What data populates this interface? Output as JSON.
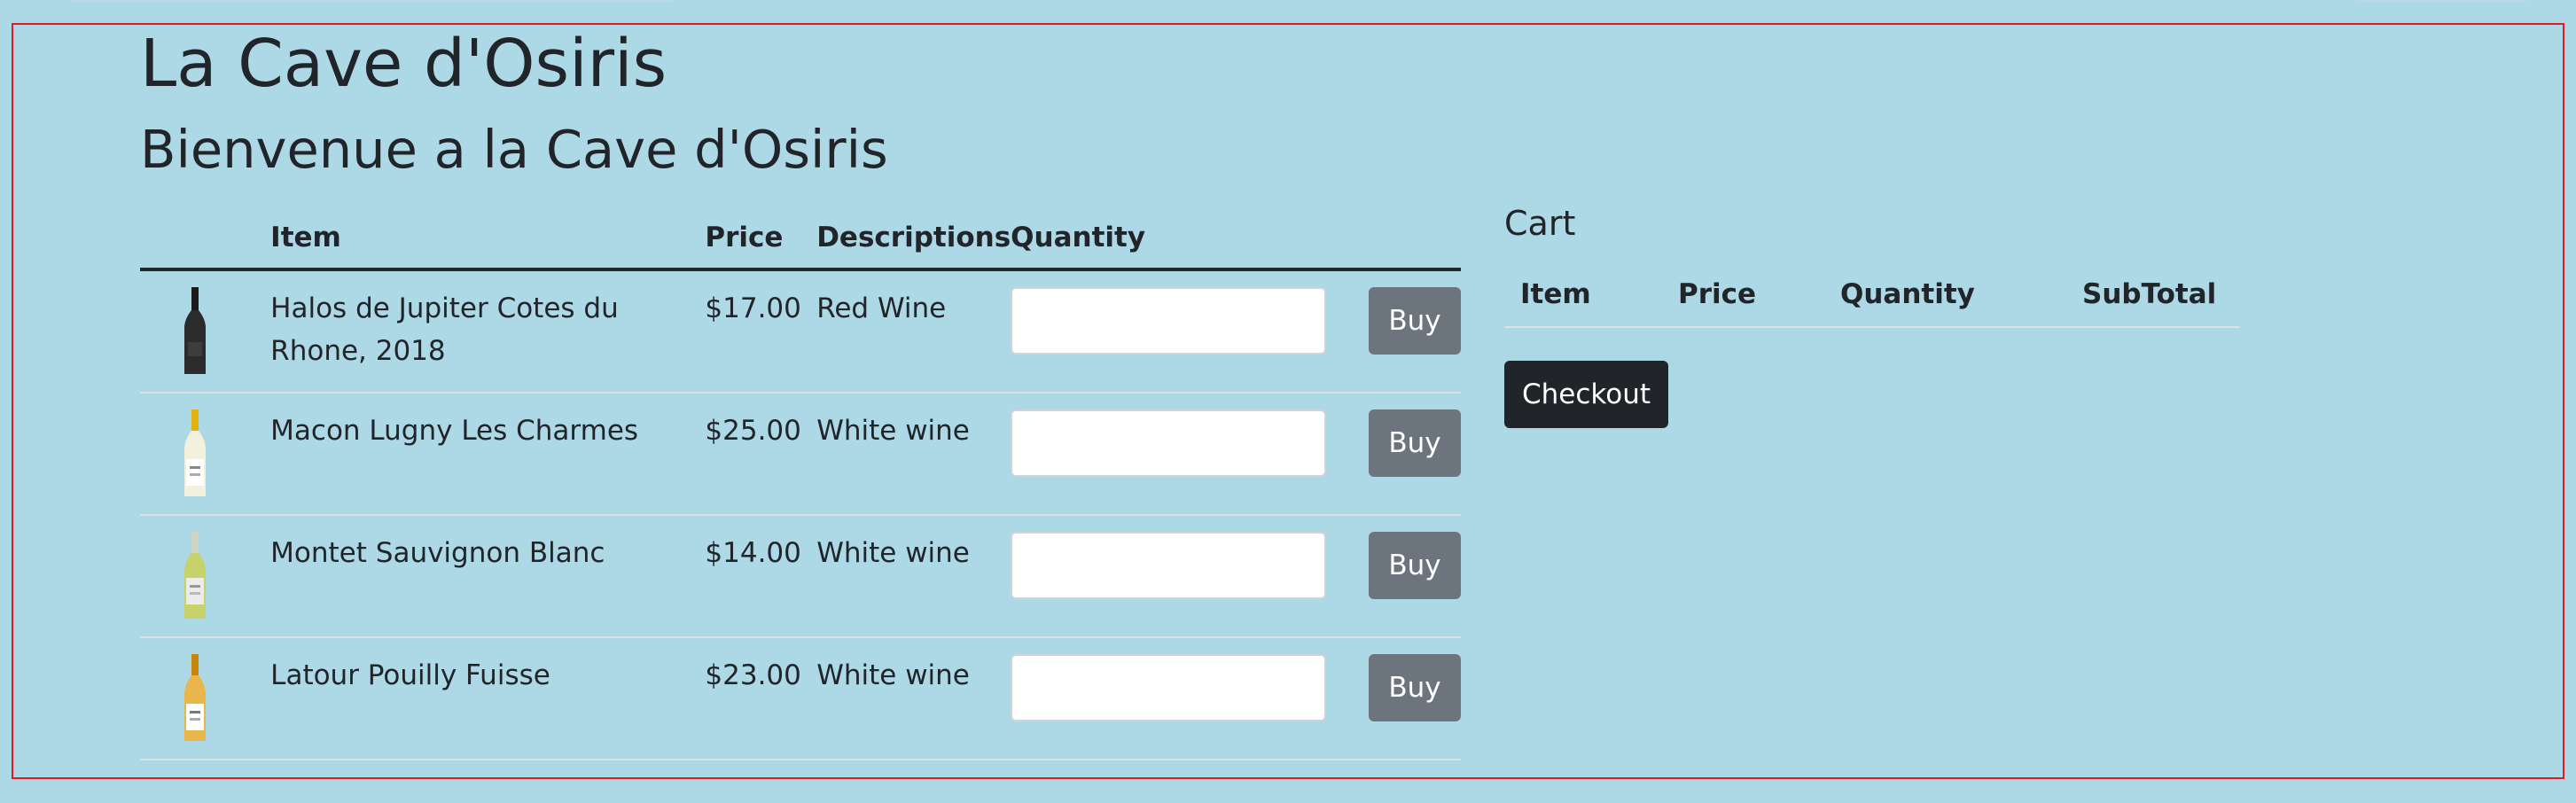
{
  "page": {
    "title": "La Cave d'Osiris",
    "welcome": "Bienvenue a la Cave d'Osiris"
  },
  "product_table": {
    "headers": [
      "",
      "Item",
      "Price",
      "Descriptions",
      "Quantity"
    ],
    "rows": [
      {
        "item": "Halos de Jupiter Cotes du Rhone, 2018",
        "price": "$17.00",
        "description": "Red Wine",
        "quantity": "",
        "buy_label": "Buy",
        "bottle_icon": "red-wine-bottle-icon"
      },
      {
        "item": "Macon Lugny Les Charmes",
        "price": "$25.00",
        "description": "White wine",
        "quantity": "",
        "buy_label": "Buy",
        "bottle_icon": "white-wine-bottle-icon"
      },
      {
        "item": "Montet Sauvignon Blanc",
        "price": "$14.00",
        "description": "White wine",
        "quantity": "",
        "buy_label": "Buy",
        "bottle_icon": "white-wine-bottle-icon"
      },
      {
        "item": "Latour Pouilly Fuisse",
        "price": "$23.00",
        "description": "White wine",
        "quantity": "",
        "buy_label": "Buy",
        "bottle_icon": "white-wine-bottle-icon"
      }
    ]
  },
  "cart": {
    "title": "Cart",
    "headers": [
      "Item",
      "Price",
      "Quantity",
      "SubTotal"
    ],
    "checkout_label": "Checkout"
  },
  "colors": {
    "page_background": "#add8e6",
    "frame_border": "#e01b24",
    "buy_button": "#6c757d",
    "checkout_button": "#212529"
  }
}
